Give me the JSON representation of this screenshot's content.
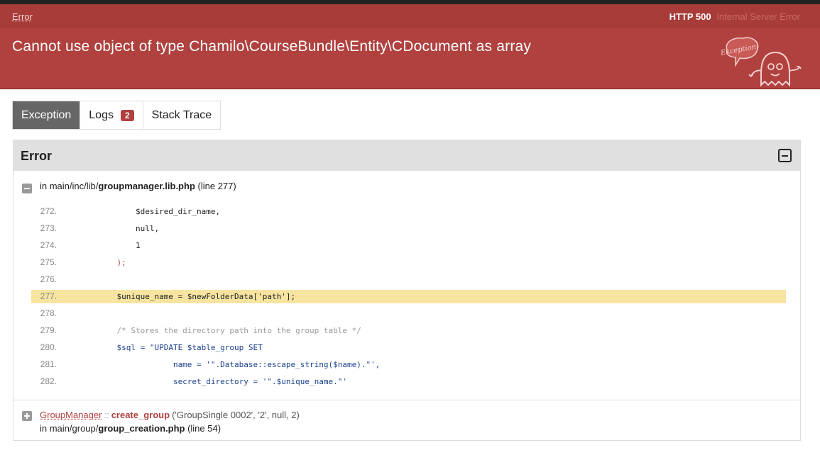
{
  "header": {
    "error_label": "Error",
    "http_code": "HTTP 500",
    "http_text": "Internal Server Error",
    "message": "Cannot use object of type Chamilo\\CourseBundle\\Entity\\CDocument as array",
    "mascot_text": "Exception!"
  },
  "tabs": [
    {
      "label": "Exception",
      "active": true
    },
    {
      "label": "Logs",
      "badge": "2"
    },
    {
      "label": "Stack Trace"
    }
  ],
  "panel": {
    "title": "Error",
    "frame1": {
      "prefix": "in main/inc/lib/",
      "file": "groupmanager.lib.php",
      "line": "(line 277)"
    },
    "code_lines": [
      {
        "n": "272.",
        "text": "                $desired_dir_name,"
      },
      {
        "n": "273.",
        "text": "                null,"
      },
      {
        "n": "274.",
        "text": "                1"
      },
      {
        "n": "275.",
        "text": "            );"
      },
      {
        "n": "276.",
        "text": ""
      },
      {
        "n": "277.",
        "text": "            $unique_name = $newFolderData['path'];"
      },
      {
        "n": "278.",
        "text": ""
      },
      {
        "n": "279.",
        "text": "            /* Stores the directory path into the group table */"
      },
      {
        "n": "280.",
        "text": "            $sql = \"UPDATE $table_group SET"
      },
      {
        "n": "281.",
        "text": "                        name = '\".Database::escape_string($name).\"',"
      },
      {
        "n": "282.",
        "text": "                        secret_directory = '\".$unique_name.\"'"
      }
    ],
    "frame2": {
      "class": "GroupManager",
      "separator": "::",
      "function": "create_group",
      "args": "('GroupSingle 0002', '2', null, 2)",
      "prefix": "in main/group/",
      "file": "group_creation.php",
      "line": "(line 54)"
    }
  },
  "colors": {
    "header_bg": "#b0413e",
    "highlight": "#f7e4a0",
    "active_tab": "#666666"
  }
}
